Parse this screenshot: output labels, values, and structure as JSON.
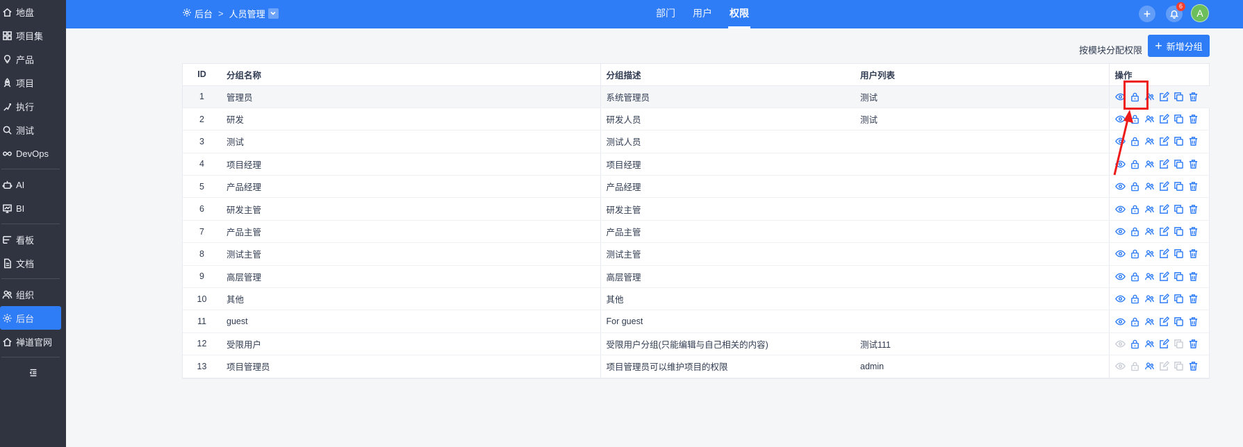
{
  "sidebar": {
    "items": [
      {
        "label": "地盘",
        "icon": "home-icon",
        "active": false
      },
      {
        "label": "项目集",
        "icon": "grid-icon",
        "active": false
      },
      {
        "label": "产品",
        "icon": "lightbulb-icon",
        "active": false
      },
      {
        "label": "项目",
        "icon": "rocket-icon",
        "active": false
      },
      {
        "label": "执行",
        "icon": "run-icon",
        "active": false
      },
      {
        "label": "测试",
        "icon": "search-icon",
        "active": false
      },
      {
        "label": "DevOps",
        "icon": "infinity-icon",
        "active": false
      },
      {
        "label": "AI",
        "icon": "robot-icon",
        "active": false
      },
      {
        "label": "BI",
        "icon": "chart-icon",
        "active": false
      },
      {
        "label": "看板",
        "icon": "board-icon",
        "active": false
      },
      {
        "label": "文档",
        "icon": "document-icon",
        "active": false
      },
      {
        "label": "组织",
        "icon": "people-icon",
        "active": false
      },
      {
        "label": "后台",
        "icon": "gear-icon",
        "active": true
      },
      {
        "label": "禅道官网",
        "icon": "home-icon",
        "active": false
      }
    ]
  },
  "header": {
    "breadcrumb": {
      "root": "后台",
      "current": "人员管理"
    },
    "tabs": [
      {
        "label": "部门",
        "active": false
      },
      {
        "label": "用户",
        "active": false
      },
      {
        "label": "权限",
        "active": true
      }
    ],
    "notification_count": "6",
    "avatar_letter": "A"
  },
  "toolbar": {
    "assign_by_module": "按模块分配权限",
    "add_group": "新增分组"
  },
  "table": {
    "columns": {
      "id": "ID",
      "name": "分组名称",
      "desc": "分组描述",
      "users": "用户列表",
      "actions": "操作"
    },
    "rows": [
      {
        "id": "1",
        "name": "管理员",
        "desc": "系统管理员",
        "users": "测试",
        "limited": false
      },
      {
        "id": "2",
        "name": "研发",
        "desc": "研发人员",
        "users": "测试",
        "limited": false
      },
      {
        "id": "3",
        "name": "测试",
        "desc": "测试人员",
        "users": "",
        "limited": false
      },
      {
        "id": "4",
        "name": "项目经理",
        "desc": "项目经理",
        "users": "",
        "limited": false
      },
      {
        "id": "5",
        "name": "产品经理",
        "desc": "产品经理",
        "users": "",
        "limited": false
      },
      {
        "id": "6",
        "name": "研发主管",
        "desc": "研发主管",
        "users": "",
        "limited": false
      },
      {
        "id": "7",
        "name": "产品主管",
        "desc": "产品主管",
        "users": "",
        "limited": false
      },
      {
        "id": "8",
        "name": "测试主管",
        "desc": "测试主管",
        "users": "",
        "limited": false
      },
      {
        "id": "9",
        "name": "高层管理",
        "desc": "高层管理",
        "users": "",
        "limited": false
      },
      {
        "id": "10",
        "name": "其他",
        "desc": "其他",
        "users": "",
        "limited": false
      },
      {
        "id": "11",
        "name": "guest",
        "desc": "For guest",
        "users": "",
        "limited": false
      },
      {
        "id": "12",
        "name": "受限用户",
        "desc": "受限用户分组(只能编辑与自己相关的内容)",
        "users": "测试111",
        "limited": "partial"
      },
      {
        "id": "13",
        "name": "项目管理员",
        "desc": "项目管理员可以维护项目的权限",
        "users": "admin",
        "limited": "all"
      }
    ]
  },
  "colors": {
    "primary": "#2e7cf6",
    "sidebar": "#2f3440",
    "annotation": "#ee1b1b"
  }
}
